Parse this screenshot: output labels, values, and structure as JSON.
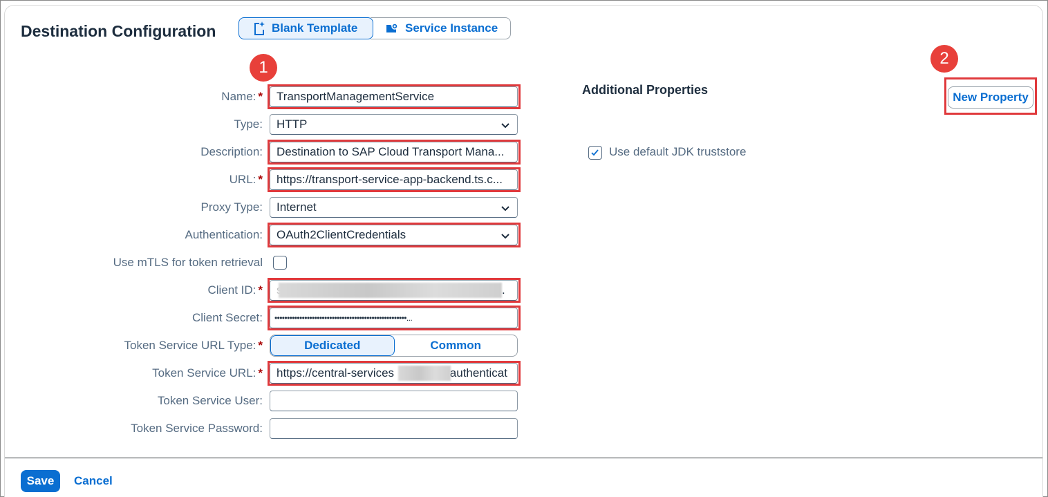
{
  "header": {
    "title": "Destination Configuration",
    "tabs": [
      {
        "label": "Blank Template",
        "icon": "blank-template-icon",
        "selected": true
      },
      {
        "label": "Service Instance",
        "icon": "service-instance-icon",
        "selected": false
      }
    ]
  },
  "badges": [
    "1",
    "2"
  ],
  "form": {
    "name": {
      "label": "Name:",
      "required": "*",
      "value": "TransportManagementService"
    },
    "type": {
      "label": "Type:",
      "value": "HTTP"
    },
    "description": {
      "label": "Description:",
      "value": "Destination to SAP Cloud Transport Mana..."
    },
    "url": {
      "label": "URL:",
      "required": "*",
      "value": "https://transport-service-app-backend.ts.c..."
    },
    "proxy_type": {
      "label": "Proxy Type:",
      "value": "Internet"
    },
    "authentication": {
      "label": "Authentication:",
      "value": "OAuth2ClientCredentials"
    },
    "mtls": {
      "label": "Use mTLS for token retrieval",
      "checked": false
    },
    "client_id": {
      "label": "Client ID:",
      "required": "*",
      "prefix": "s",
      "suffix": "."
    },
    "client_secret": {
      "label": "Client Secret:",
      "value": "•••••••••••••••••••••••••••••••••••••••••••••••••••••..."
    },
    "token_url_type": {
      "label": "Token Service URL Type:",
      "required": "*",
      "options": [
        "Dedicated",
        "Common"
      ],
      "selected": "Dedicated"
    },
    "token_url": {
      "label": "Token Service URL:",
      "required": "*",
      "prefix": "https://central-services",
      "suffix": ".authenticat"
    },
    "token_user": {
      "label": "Token Service User:",
      "value": ""
    },
    "token_password": {
      "label": "Token Service Password:",
      "value": ""
    }
  },
  "additional": {
    "title": "Additional Properties",
    "new_property": "New Property",
    "jdk_truststore": {
      "label": "Use default JDK truststore",
      "checked": true
    }
  },
  "footer": {
    "save": "Save",
    "cancel": "Cancel"
  },
  "colors": {
    "accent": "#0a6ed1",
    "highlight": "#e0393c",
    "badge": "#e8403a",
    "required": "#aa0808"
  }
}
